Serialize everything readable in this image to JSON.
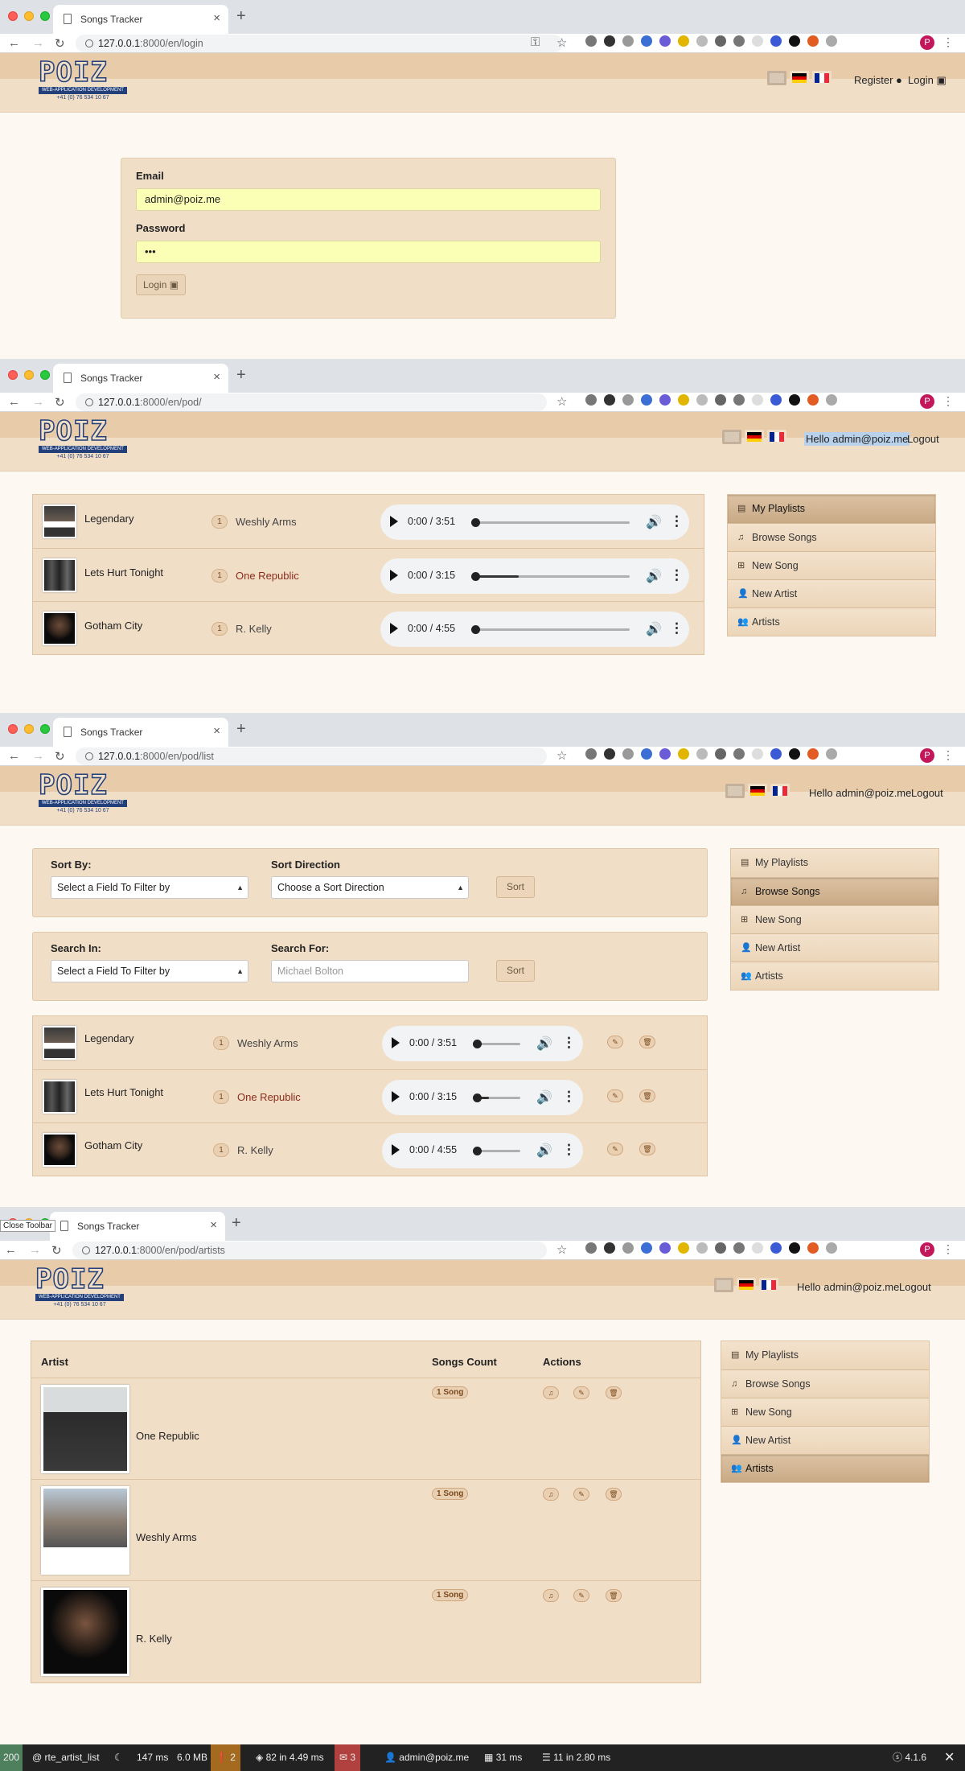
{
  "browser": {
    "tab_title": "Songs Tracker",
    "url_host": "127.0.0.1",
    "url_login": ":8000/en/login",
    "url_pod": ":8000/en/pod/",
    "url_list": ":8000/en/pod/list",
    "url_artists": ":8000/en/pod/artists",
    "profile_letter": "P"
  },
  "logo": {
    "text": "POIZ",
    "strip": "WEB-APPLICATION DEVELOPMENT",
    "phone": "+41 (0) 76 534 10 67"
  },
  "header": {
    "register": "Register",
    "login": "Login",
    "hello": "Hello admin@poiz.me",
    "logout": "Logout"
  },
  "login": {
    "email_label": "Email",
    "email_value": "admin@poiz.me",
    "password_label": "Password",
    "password_value": "•••",
    "button": "Login"
  },
  "songs": [
    {
      "title": "Legendary",
      "count": "1",
      "artist": "Weshly Arms",
      "time": "0:00 / 3:51",
      "progress": 0.0
    },
    {
      "title": "Lets Hurt Tonight",
      "count": "1",
      "artist": "One Republic",
      "time": "0:00 / 3:15",
      "progress": 0.28
    },
    {
      "title": "Gotham City",
      "count": "1",
      "artist": "R. Kelly",
      "time": "0:00 / 4:55",
      "progress": 0.0
    }
  ],
  "sidebar": {
    "items": [
      "My Playlists",
      "Browse Songs",
      "New Song",
      "New Artist",
      "Artists"
    ]
  },
  "filters": {
    "sort_by_label": "Sort By:",
    "sort_by_value": "Select a Field To Filter by",
    "sort_dir_label": "Sort Direction",
    "sort_dir_value": "Choose a Sort Direction",
    "sort_button": "Sort",
    "search_in_label": "Search In:",
    "search_in_value": "Select a Field To Filter by",
    "search_for_label": "Search For:",
    "search_for_placeholder": "Michael Bolton",
    "search_button": "Sort"
  },
  "artists_table": {
    "headers": [
      "Artist",
      "Songs Count",
      "Actions"
    ],
    "rows": [
      {
        "name": "One Republic",
        "count": "1 Song"
      },
      {
        "name": "Weshly Arms",
        "count": "1 Song"
      },
      {
        "name": "R. Kelly",
        "count": "1 Song"
      }
    ]
  },
  "devtools": {
    "close_toolbar": "Close Toolbar",
    "status": "200",
    "route": "@ rte_artist_list",
    "time": "147 ms",
    "memory": "6.0 MB",
    "warnings": "2",
    "twig": "82 in 4.49 ms",
    "errors": "3",
    "user": "admin@poiz.me",
    "db_time": "31 ms",
    "cache": "11 in 2.80 ms",
    "version": "4.1.6"
  },
  "colors": {
    "header_top": "#e8ccaa",
    "header_bottom": "#f1dec7",
    "panel": "#f1dec7",
    "autofill": "#fbffb5",
    "page": "#fdf8f1"
  }
}
